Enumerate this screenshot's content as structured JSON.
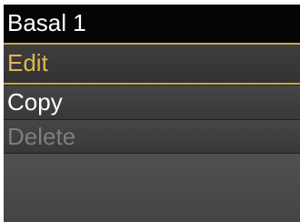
{
  "header": {
    "title": "Basal 1"
  },
  "menu": {
    "items": [
      {
        "label": "Edit",
        "state": "selected"
      },
      {
        "label": "Copy",
        "state": "enabled"
      },
      {
        "label": "Delete",
        "state": "disabled"
      }
    ]
  },
  "colors": {
    "selection_accent": "#c8a545",
    "selected_text": "#e2b64f",
    "enabled_text": "#ffffff",
    "disabled_text": "#7e7e7e",
    "title_background": "#050505"
  }
}
